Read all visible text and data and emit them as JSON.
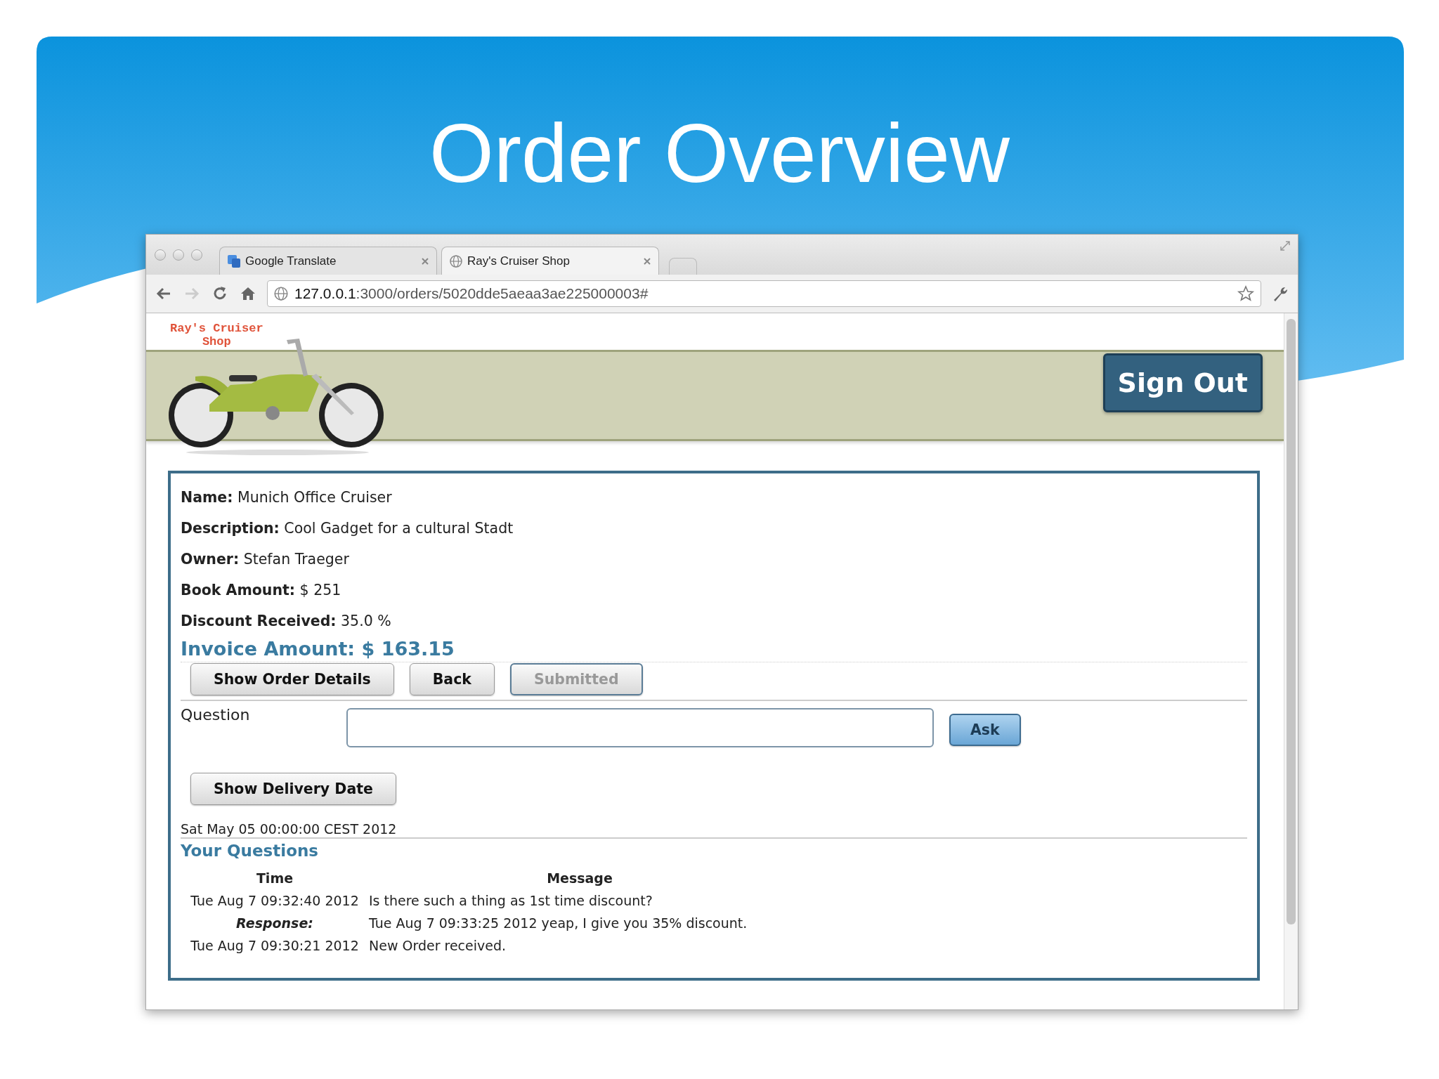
{
  "slide": {
    "title": "Order Overview"
  },
  "browser": {
    "tabs": [
      {
        "label": "Google Translate",
        "kind": "translate",
        "selected": false
      },
      {
        "label": "Ray's Cruiser Shop",
        "kind": "globe",
        "selected": true
      }
    ],
    "url": {
      "host": "127.0.0.1",
      "path": ":3000/orders/5020dde5aeaa3ae225000003#"
    }
  },
  "header": {
    "logo_lines": [
      "Ray's Cruiser",
      "Shop"
    ],
    "sign_out": "Sign Out"
  },
  "details": [
    {
      "label": "Name:",
      "value": "Munich Office Cruiser"
    },
    {
      "label": "Description:",
      "value": "Cool Gadget for a cultural Stadt"
    },
    {
      "label": "Owner:",
      "value": "Stefan Traeger"
    },
    {
      "label": "Book Amount:",
      "value": "$ 251"
    },
    {
      "label": "Discount Received:",
      "value": "35.0 %"
    }
  ],
  "invoice": "Invoice Amount: $ 163.15",
  "actions": [
    {
      "label": "Show Order Details",
      "disabled": false
    },
    {
      "label": "Back",
      "disabled": false
    },
    {
      "label": "Submitted",
      "disabled": true
    }
  ],
  "question": {
    "label": "Question",
    "button": "Ask"
  },
  "delivery": {
    "button": "Show Delivery Date",
    "date": "Sat May 05 00:00:00 CEST 2012"
  },
  "questions": {
    "title": "Your Questions",
    "columns": [
      "Time",
      "Message"
    ],
    "rows": [
      {
        "kind": "question",
        "time": "Tue Aug 7 09:32:40 2012",
        "message": "Is there such a thing as 1st time discount?"
      },
      {
        "kind": "response",
        "time": "Response:",
        "message": "Tue Aug 7 09:33:25 2012 yeap, I give you 35% discount."
      },
      {
        "kind": "question",
        "time": "Tue Aug 7 09:30:21 2012",
        "message": "New Order received."
      }
    ]
  }
}
